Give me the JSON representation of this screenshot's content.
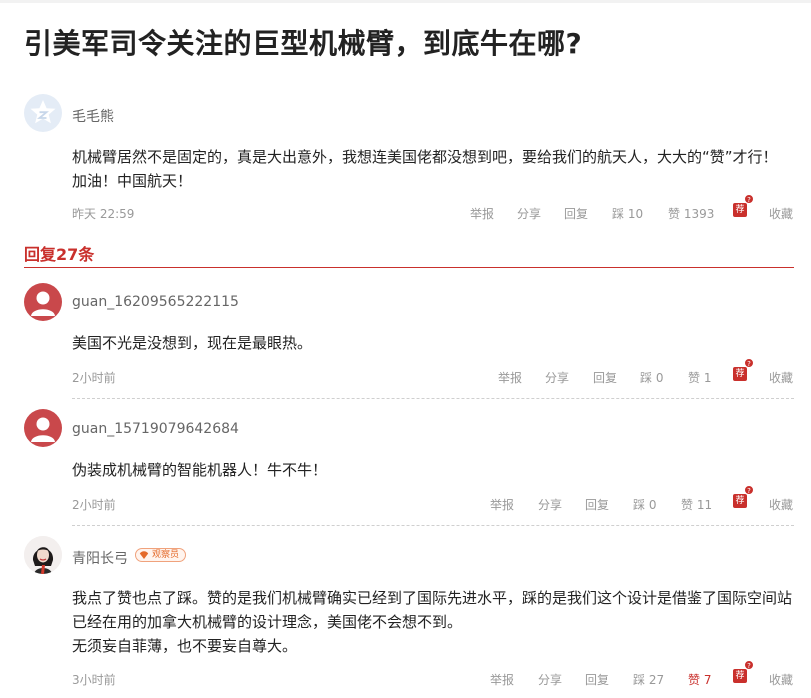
{
  "page_title": "引美军司令关注的巨型机械臂，到底牛在哪?",
  "main_comment": {
    "user": "毛毛熊",
    "text_line1": "机械臂居然不是固定的，真是大出意外，我想连美国佬都没想到吧，要给我们的航天人，大大的“赞”才行！",
    "text_line2": "加油！中国航天！",
    "time": "昨天 22:59",
    "report": "举报",
    "share": "分享",
    "reply": "回复",
    "dislike": "踩 10",
    "like": "赞 1393",
    "recommend": "荐",
    "recommend_badge": "?",
    "favorite": "收藏"
  },
  "replies_header": "回复27条",
  "replies": [
    {
      "user": "guan_16209565222115",
      "text": "美国不光是没想到，现在是最眼热。",
      "time": "2小时前",
      "report": "举报",
      "share": "分享",
      "reply": "回复",
      "dislike": "踩 0",
      "like": "赞 1",
      "recommend": "荐",
      "recommend_badge": "?",
      "favorite": "收藏"
    },
    {
      "user": "guan_15719079642684",
      "text": "伪装成机械臂的智能机器人！牛不牛！",
      "time": "2小时前",
      "report": "举报",
      "share": "分享",
      "reply": "回复",
      "dislike": "踩 0",
      "like": "赞 11",
      "recommend": "荐",
      "recommend_badge": "?",
      "favorite": "收藏"
    },
    {
      "user": "青阳长弓",
      "badge": "观察员",
      "text_line1": "我点了赞也点了踩。赞的是我们机械臂确实已经到了国际先进水平，踩的是我们这个设计是借鉴了国际空间站",
      "text_line2": "已经在用的加拿大机械臂的设计理念，美国佬不会想不到。",
      "text_line3": "无须妄自菲薄，也不要妄自尊大。",
      "time": "3小时前",
      "report": "举报",
      "share": "分享",
      "reply": "回复",
      "dislike": "踩 27",
      "like": "赞 7",
      "recommend": "荐",
      "recommend_badge": "?",
      "favorite": "收藏"
    }
  ],
  "colors": {
    "accent": "#c9302c",
    "meta": "#999999",
    "badge": "#e46a2a"
  }
}
